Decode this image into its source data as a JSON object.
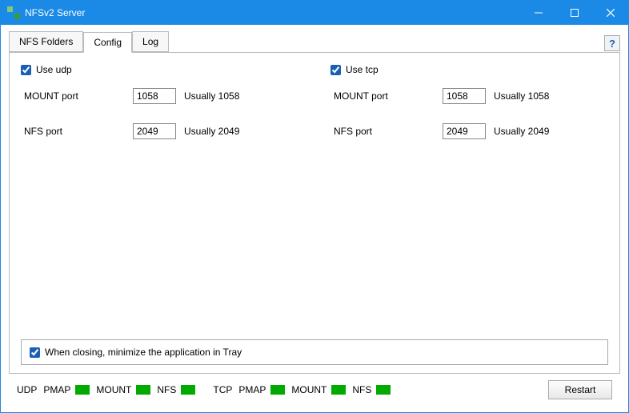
{
  "window": {
    "title": "NFSv2 Server"
  },
  "tabs": {
    "nfs_folders": "NFS Folders",
    "config": "Config",
    "log": "Log"
  },
  "help": "?",
  "udp": {
    "checkbox_label": "Use udp",
    "mount": {
      "label": "MOUNT port",
      "value": "1058",
      "hint": "Usually 1058"
    },
    "nfs": {
      "label": "NFS port",
      "value": "2049",
      "hint": "Usually 2049"
    }
  },
  "tcp": {
    "checkbox_label": "Use tcp",
    "mount": {
      "label": "MOUNT port",
      "value": "1058",
      "hint": "Usually 1058"
    },
    "nfs": {
      "label": "NFS port",
      "value": "2049",
      "hint": "Usually 2049"
    }
  },
  "tray": {
    "label": "When closing, minimize the application in Tray"
  },
  "status": {
    "udp_label": "UDP",
    "tcp_label": "TCP",
    "pmap": "PMAP",
    "mount": "MOUNT",
    "nfs": "NFS",
    "restart": "Restart"
  }
}
